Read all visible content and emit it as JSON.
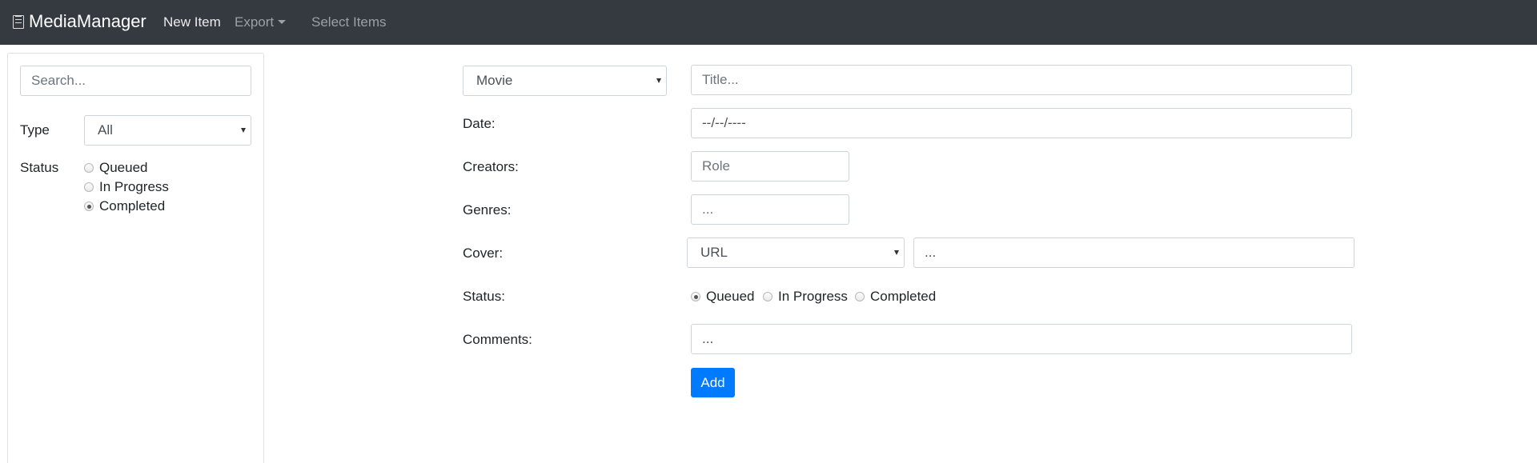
{
  "navbar": {
    "brand": "MediaManager",
    "brand_icon": "book-icon",
    "new_item": "New Item",
    "export": "Export",
    "select_items": "Select Items"
  },
  "sidebar": {
    "search_placeholder": "Search...",
    "type_label": "Type",
    "type_value": "All",
    "status_label": "Status",
    "status_options": [
      "Queued",
      "In Progress",
      "Completed"
    ],
    "status_selected": "Completed"
  },
  "form": {
    "media_type": "Movie",
    "title_placeholder": "Title...",
    "date_label": "Date:",
    "date_placeholder": "--/--/----",
    "creators_label": "Creators:",
    "creators_placeholder": "Role",
    "genres_label": "Genres:",
    "genres_placeholder": "...",
    "cover_label": "Cover:",
    "cover_type": "URL",
    "cover_placeholder": "...",
    "status_label": "Status:",
    "status_options": [
      "Queued",
      "In Progress",
      "Completed"
    ],
    "status_selected": "Queued",
    "comments_label": "Comments:",
    "comments_placeholder": "...",
    "add_button": "Add"
  },
  "colors": {
    "navbar_bg": "#343a40",
    "primary": "#007bff"
  }
}
